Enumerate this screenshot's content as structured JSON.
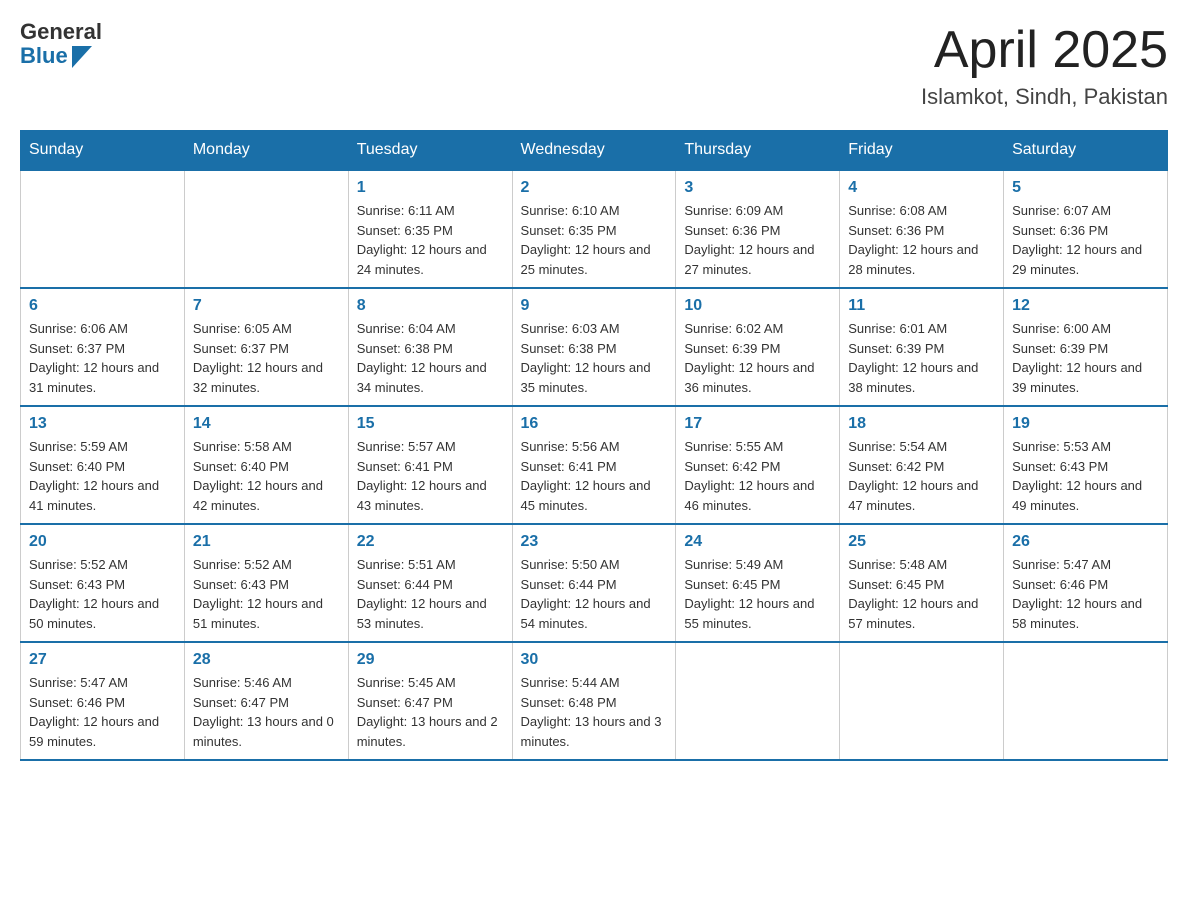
{
  "header": {
    "logo": {
      "general": "General",
      "blue": "Blue"
    },
    "title": "April 2025",
    "location": "Islamkot, Sindh, Pakistan"
  },
  "calendar": {
    "days_of_week": [
      "Sunday",
      "Monday",
      "Tuesday",
      "Wednesday",
      "Thursday",
      "Friday",
      "Saturday"
    ],
    "weeks": [
      [
        {
          "day": "",
          "info": ""
        },
        {
          "day": "",
          "info": ""
        },
        {
          "day": "1",
          "info": "Sunrise: 6:11 AM\nSunset: 6:35 PM\nDaylight: 12 hours and 24 minutes."
        },
        {
          "day": "2",
          "info": "Sunrise: 6:10 AM\nSunset: 6:35 PM\nDaylight: 12 hours and 25 minutes."
        },
        {
          "day": "3",
          "info": "Sunrise: 6:09 AM\nSunset: 6:36 PM\nDaylight: 12 hours and 27 minutes."
        },
        {
          "day": "4",
          "info": "Sunrise: 6:08 AM\nSunset: 6:36 PM\nDaylight: 12 hours and 28 minutes."
        },
        {
          "day": "5",
          "info": "Sunrise: 6:07 AM\nSunset: 6:36 PM\nDaylight: 12 hours and 29 minutes."
        }
      ],
      [
        {
          "day": "6",
          "info": "Sunrise: 6:06 AM\nSunset: 6:37 PM\nDaylight: 12 hours and 31 minutes."
        },
        {
          "day": "7",
          "info": "Sunrise: 6:05 AM\nSunset: 6:37 PM\nDaylight: 12 hours and 32 minutes."
        },
        {
          "day": "8",
          "info": "Sunrise: 6:04 AM\nSunset: 6:38 PM\nDaylight: 12 hours and 34 minutes."
        },
        {
          "day": "9",
          "info": "Sunrise: 6:03 AM\nSunset: 6:38 PM\nDaylight: 12 hours and 35 minutes."
        },
        {
          "day": "10",
          "info": "Sunrise: 6:02 AM\nSunset: 6:39 PM\nDaylight: 12 hours and 36 minutes."
        },
        {
          "day": "11",
          "info": "Sunrise: 6:01 AM\nSunset: 6:39 PM\nDaylight: 12 hours and 38 minutes."
        },
        {
          "day": "12",
          "info": "Sunrise: 6:00 AM\nSunset: 6:39 PM\nDaylight: 12 hours and 39 minutes."
        }
      ],
      [
        {
          "day": "13",
          "info": "Sunrise: 5:59 AM\nSunset: 6:40 PM\nDaylight: 12 hours and 41 minutes."
        },
        {
          "day": "14",
          "info": "Sunrise: 5:58 AM\nSunset: 6:40 PM\nDaylight: 12 hours and 42 minutes."
        },
        {
          "day": "15",
          "info": "Sunrise: 5:57 AM\nSunset: 6:41 PM\nDaylight: 12 hours and 43 minutes."
        },
        {
          "day": "16",
          "info": "Sunrise: 5:56 AM\nSunset: 6:41 PM\nDaylight: 12 hours and 45 minutes."
        },
        {
          "day": "17",
          "info": "Sunrise: 5:55 AM\nSunset: 6:42 PM\nDaylight: 12 hours and 46 minutes."
        },
        {
          "day": "18",
          "info": "Sunrise: 5:54 AM\nSunset: 6:42 PM\nDaylight: 12 hours and 47 minutes."
        },
        {
          "day": "19",
          "info": "Sunrise: 5:53 AM\nSunset: 6:43 PM\nDaylight: 12 hours and 49 minutes."
        }
      ],
      [
        {
          "day": "20",
          "info": "Sunrise: 5:52 AM\nSunset: 6:43 PM\nDaylight: 12 hours and 50 minutes."
        },
        {
          "day": "21",
          "info": "Sunrise: 5:52 AM\nSunset: 6:43 PM\nDaylight: 12 hours and 51 minutes."
        },
        {
          "day": "22",
          "info": "Sunrise: 5:51 AM\nSunset: 6:44 PM\nDaylight: 12 hours and 53 minutes."
        },
        {
          "day": "23",
          "info": "Sunrise: 5:50 AM\nSunset: 6:44 PM\nDaylight: 12 hours and 54 minutes."
        },
        {
          "day": "24",
          "info": "Sunrise: 5:49 AM\nSunset: 6:45 PM\nDaylight: 12 hours and 55 minutes."
        },
        {
          "day": "25",
          "info": "Sunrise: 5:48 AM\nSunset: 6:45 PM\nDaylight: 12 hours and 57 minutes."
        },
        {
          "day": "26",
          "info": "Sunrise: 5:47 AM\nSunset: 6:46 PM\nDaylight: 12 hours and 58 minutes."
        }
      ],
      [
        {
          "day": "27",
          "info": "Sunrise: 5:47 AM\nSunset: 6:46 PM\nDaylight: 12 hours and 59 minutes."
        },
        {
          "day": "28",
          "info": "Sunrise: 5:46 AM\nSunset: 6:47 PM\nDaylight: 13 hours and 0 minutes."
        },
        {
          "day": "29",
          "info": "Sunrise: 5:45 AM\nSunset: 6:47 PM\nDaylight: 13 hours and 2 minutes."
        },
        {
          "day": "30",
          "info": "Sunrise: 5:44 AM\nSunset: 6:48 PM\nDaylight: 13 hours and 3 minutes."
        },
        {
          "day": "",
          "info": ""
        },
        {
          "day": "",
          "info": ""
        },
        {
          "day": "",
          "info": ""
        }
      ]
    ]
  }
}
